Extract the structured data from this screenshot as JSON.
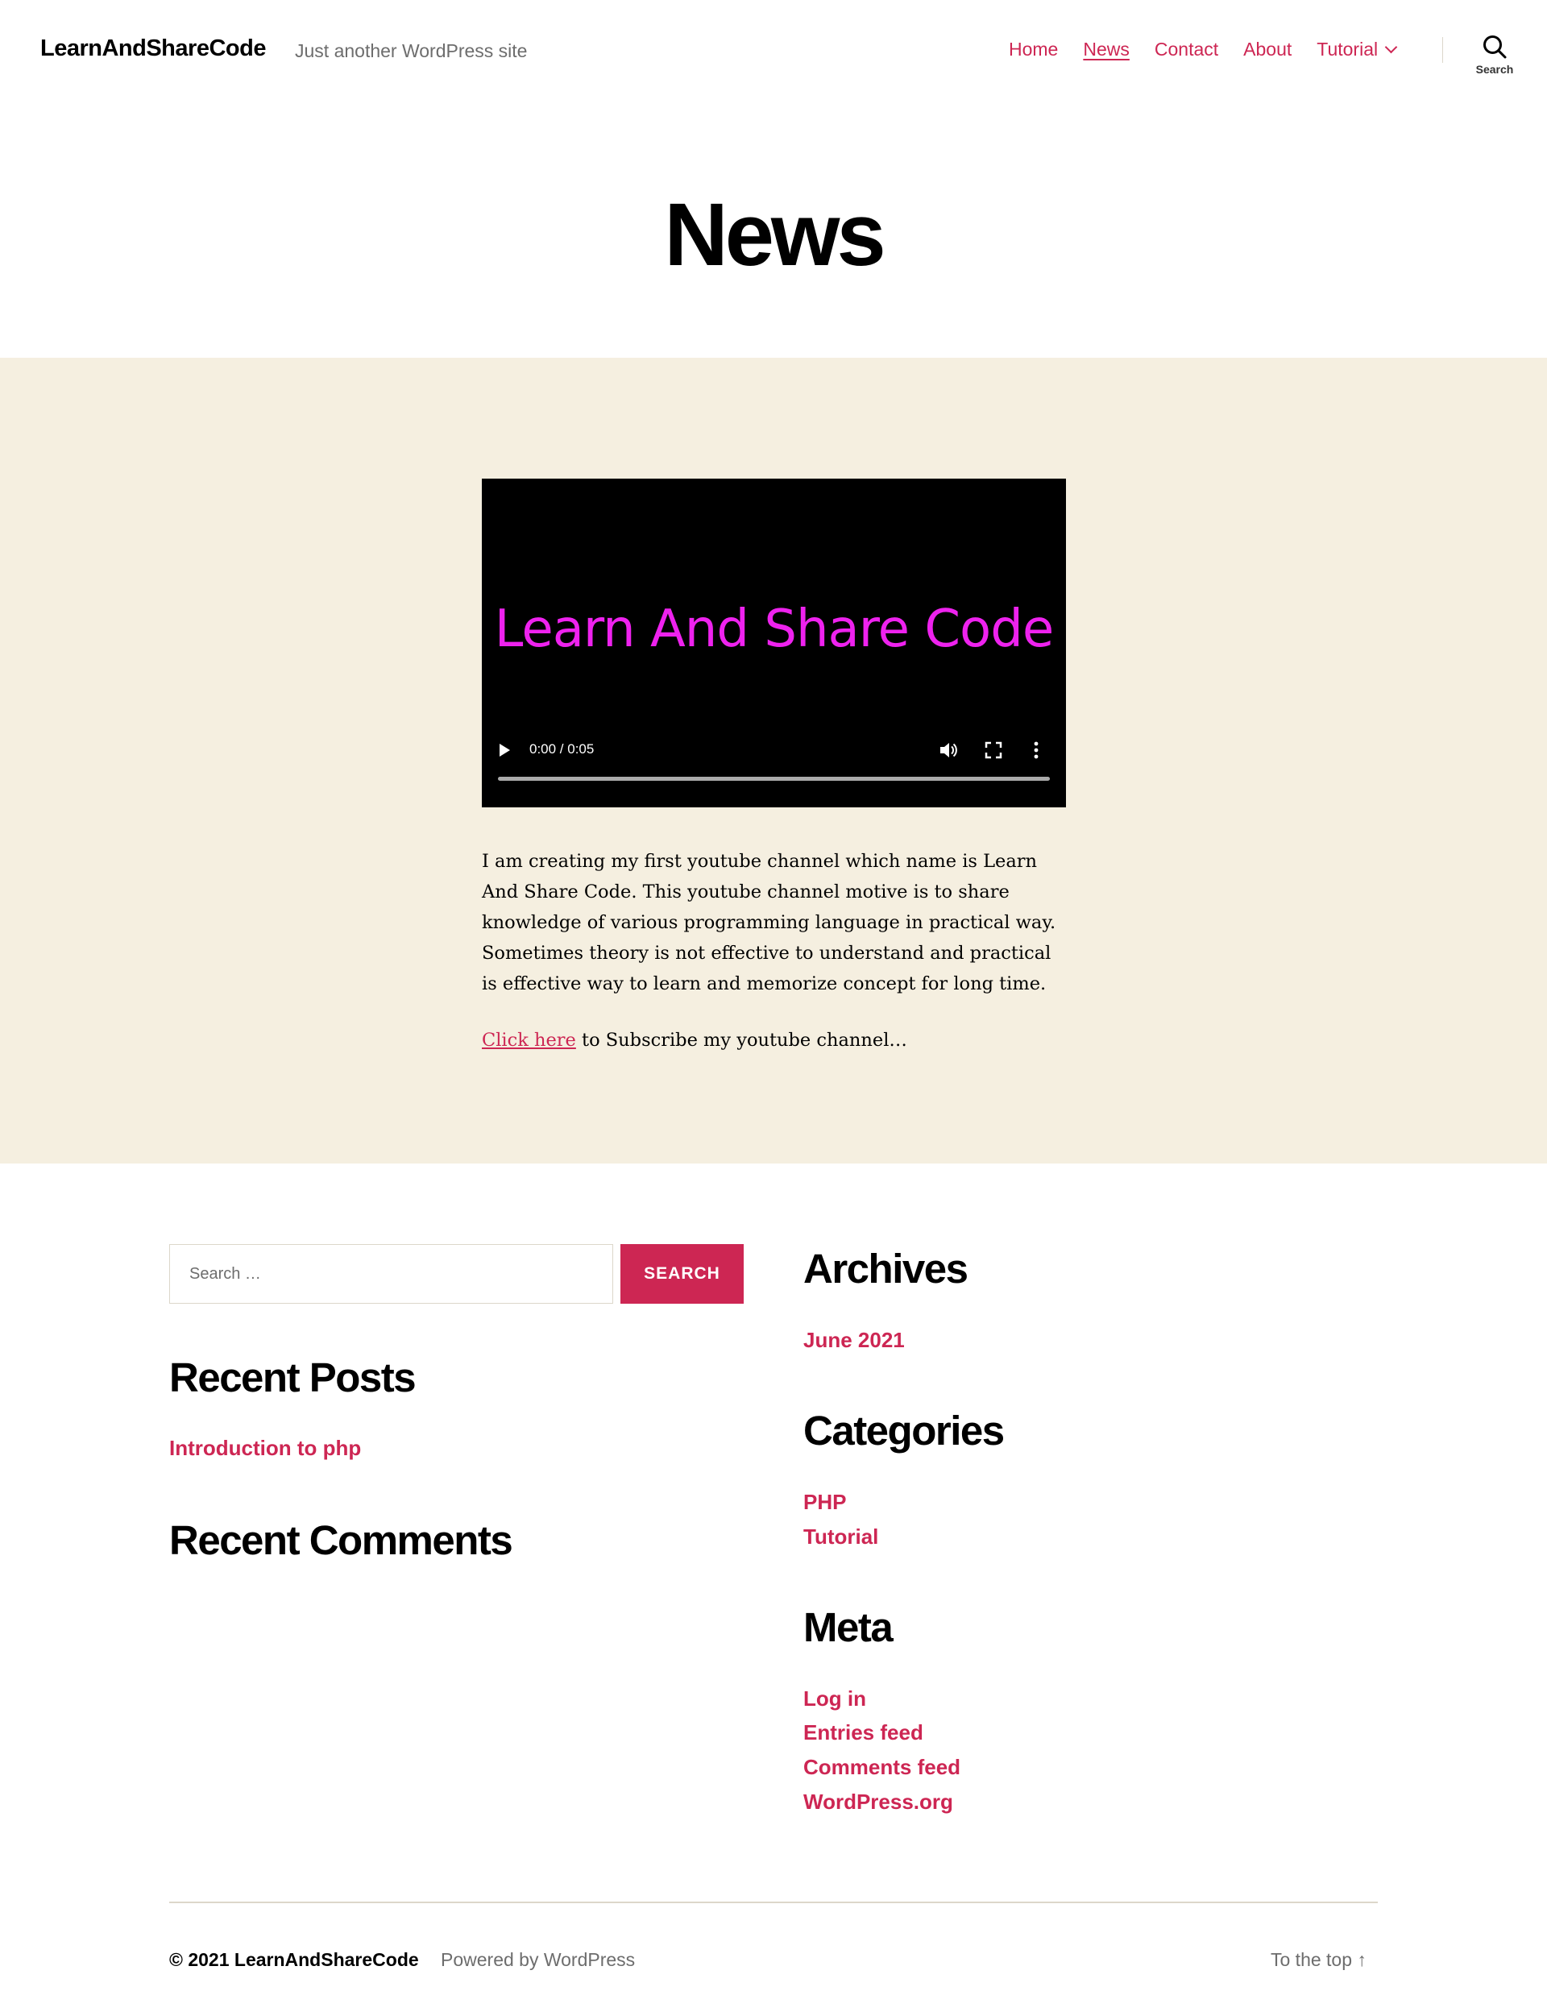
{
  "header": {
    "site_title": "LearnAndShareCode",
    "site_description": "Just another WordPress site",
    "nav": [
      {
        "label": "Home"
      },
      {
        "label": "News",
        "current": true
      },
      {
        "label": "Contact"
      },
      {
        "label": "About"
      },
      {
        "label": "Tutorial",
        "has_submenu": true
      }
    ],
    "search_label": "Search"
  },
  "page": {
    "title": "News"
  },
  "video": {
    "overlay_text": "Learn And Share Code",
    "time": "0:00 / 0:05",
    "progress": 0
  },
  "post": {
    "paragraph": "I am creating my first youtube channel which name is Learn And Share Code. This youtube channel motive is to share knowledge of various programming language in practical way. Sometimes theory is not effective to understand and practical is effective way to learn and memorize concept for long time.",
    "link_text": "Click here",
    "link_suffix": " to Subscribe my youtube channel…"
  },
  "widgets": {
    "search": {
      "placeholder": "Search …",
      "button_label": "SEARCH"
    },
    "recent_posts": {
      "title": "Recent Posts",
      "items": [
        "Introduction to php"
      ]
    },
    "recent_comments": {
      "title": "Recent Comments"
    },
    "archives": {
      "title": "Archives",
      "items": [
        "June 2021"
      ]
    },
    "categories": {
      "title": "Categories",
      "items": [
        "PHP",
        "Tutorial"
      ]
    },
    "meta": {
      "title": "Meta",
      "items": [
        "Log in",
        "Entries feed",
        "Comments feed",
        "WordPress.org"
      ]
    }
  },
  "footer": {
    "copyright": "© 2021 LearnAndShareCode",
    "powered_by": "Powered by WordPress",
    "to_top": "To the top ↑"
  },
  "colors": {
    "accent": "#cd2653",
    "band_background": "#f5efe0",
    "video_text": "#ee22ee"
  }
}
